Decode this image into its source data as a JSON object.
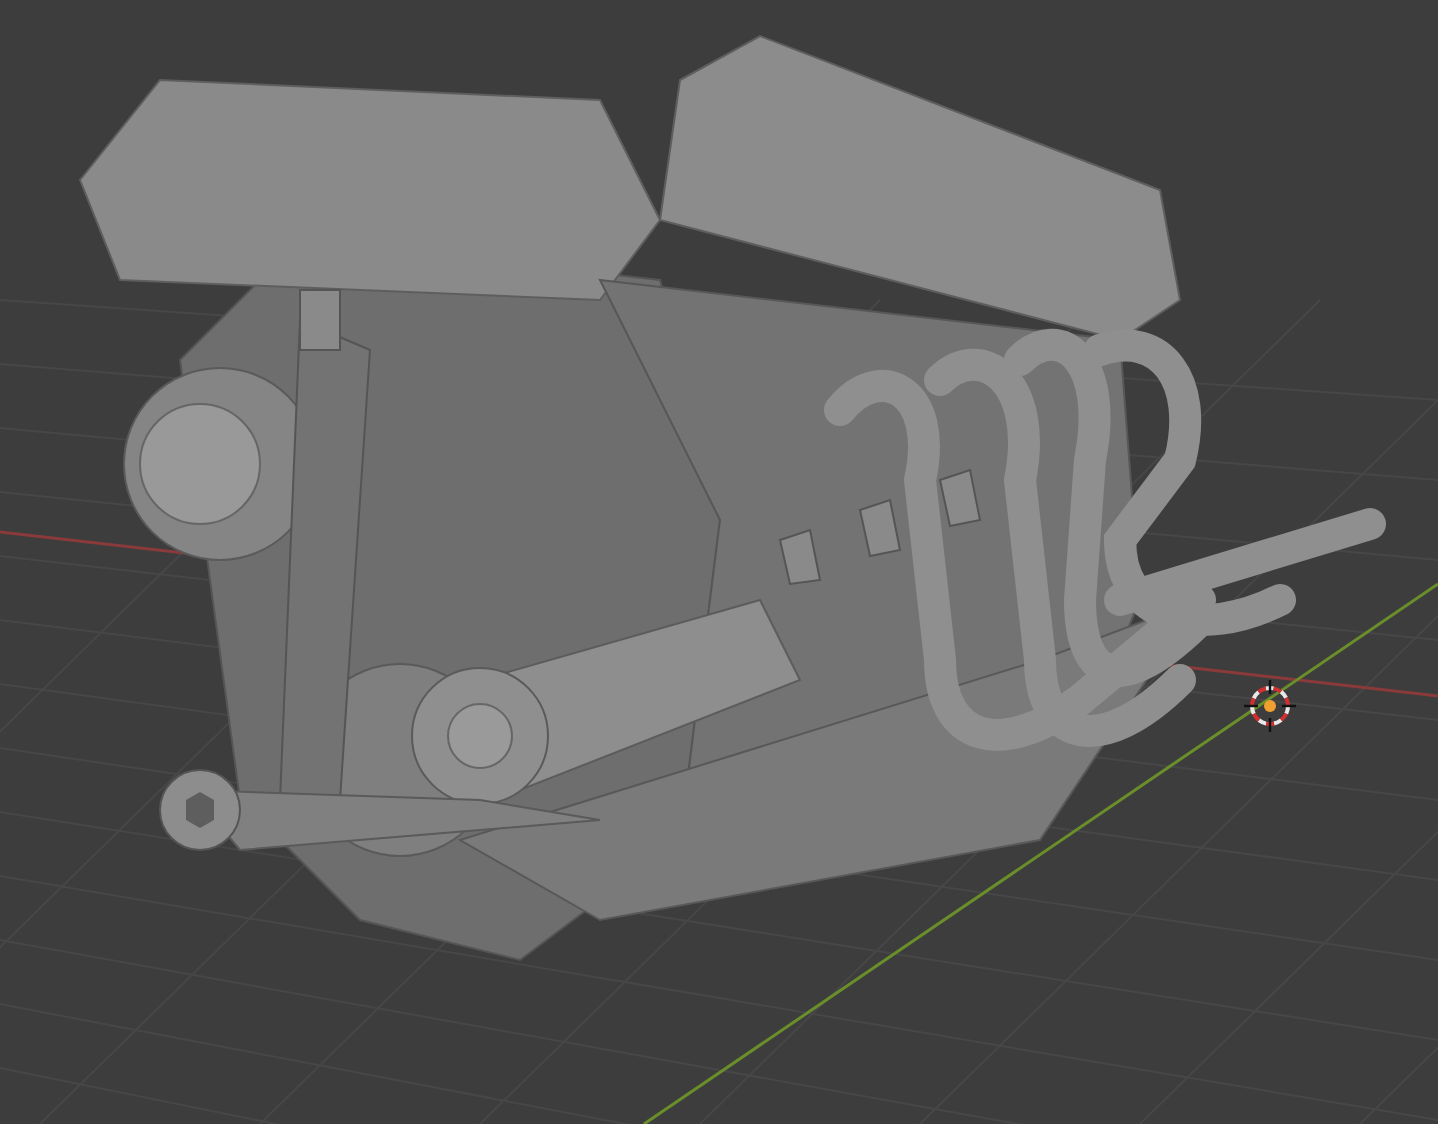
{
  "viewport": {
    "grid": true,
    "axes": true,
    "cursor": true
  }
}
